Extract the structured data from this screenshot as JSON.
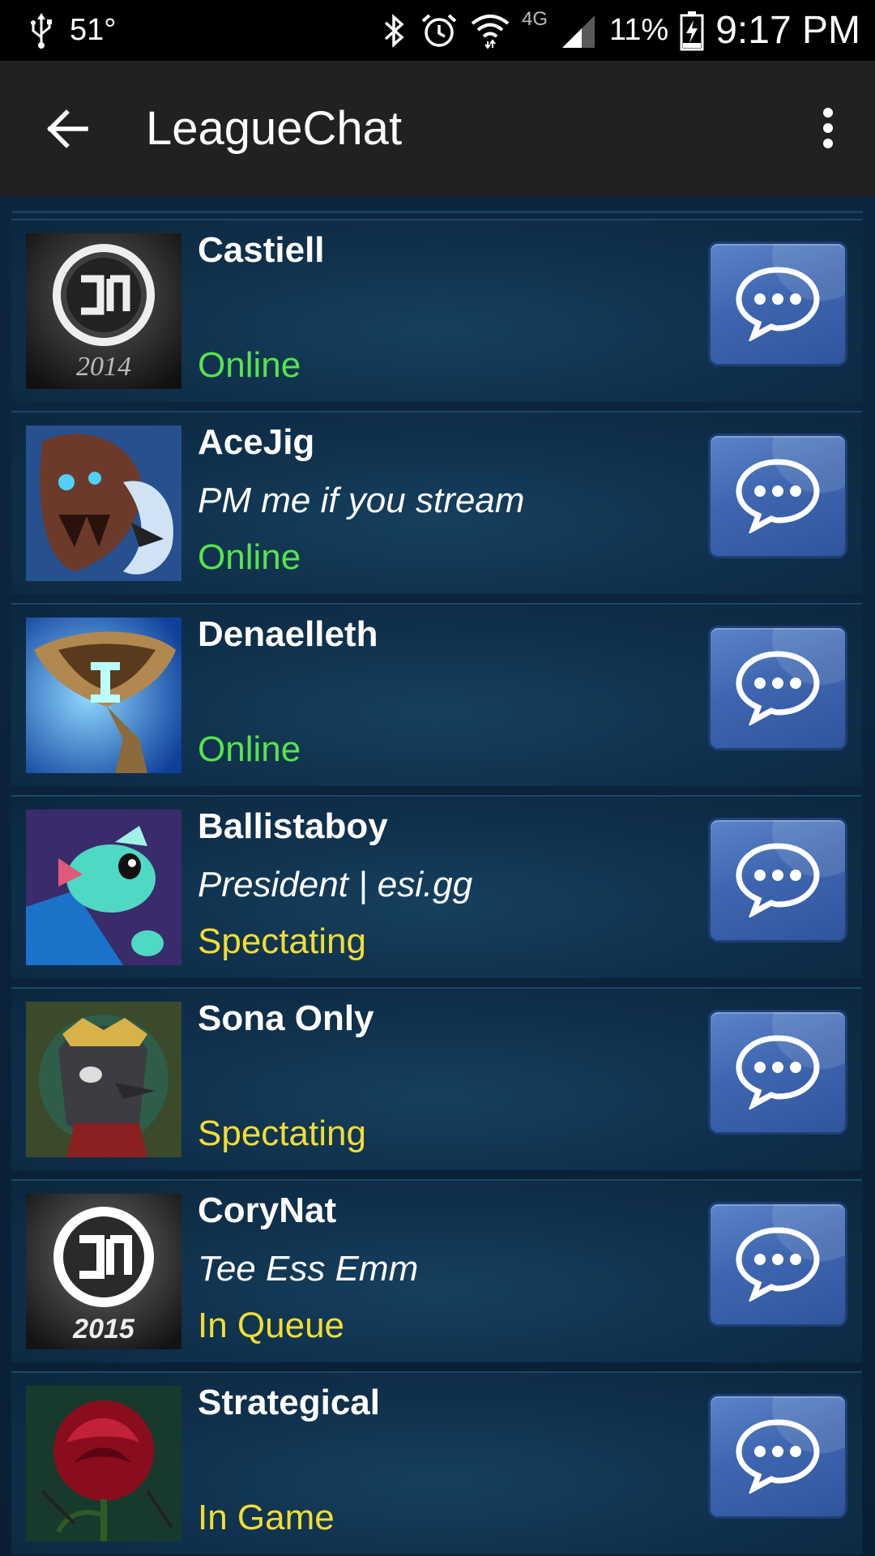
{
  "status_bar": {
    "temperature": "51°",
    "network": "4G",
    "battery": "11%",
    "time": "9:17 PM",
    "icons": [
      "usb-icon",
      "bluetooth-icon",
      "alarm-icon",
      "wifi-icon",
      "signal-icon",
      "battery-charging-icon"
    ]
  },
  "app_bar": {
    "title": "LeagueChat",
    "back_icon": "arrow-left-icon",
    "menu_icon": "more-vertical-icon"
  },
  "colors": {
    "online": "#58e34a",
    "busy": "#f2dd33",
    "chat_button": "#3e66b0"
  },
  "friends": [
    {
      "name": "Castiell",
      "status_message": "",
      "presence": "Online",
      "presence_type": "online",
      "avatar": "tsm-2014-icon",
      "avatar_caption": "2014"
    },
    {
      "name": "AceJig",
      "status_message": "PM me if you stream",
      "presence": "Online",
      "presence_type": "online",
      "avatar": "champion-monster-icon",
      "avatar_caption": ""
    },
    {
      "name": "Denaelleth",
      "status_message": "",
      "presence": "Online",
      "presence_type": "online",
      "avatar": "trophy-icon",
      "avatar_caption": ""
    },
    {
      "name": "Ballistaboy",
      "status_message": "President | esi.gg",
      "presence": "Spectating",
      "presence_type": "busy",
      "avatar": "poro-bird-icon",
      "avatar_caption": ""
    },
    {
      "name": "Sona Only",
      "status_message": "",
      "presence": "Spectating",
      "presence_type": "busy",
      "avatar": "crowned-bird-icon",
      "avatar_caption": ""
    },
    {
      "name": "CoryNat",
      "status_message": "Tee Ess Emm",
      "presence": "In Queue",
      "presence_type": "busy",
      "avatar": "tsm-2015-icon",
      "avatar_caption": "2015"
    },
    {
      "name": "Strategical",
      "status_message": "",
      "presence": "In Game",
      "presence_type": "busy",
      "avatar": "rose-icon",
      "avatar_caption": ""
    }
  ]
}
